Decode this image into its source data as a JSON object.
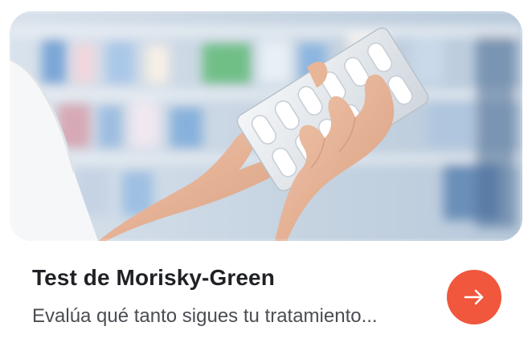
{
  "card": {
    "image_alt_icon": "pharmacy-blister-pack-photo",
    "title": "Test de Morisky-Green",
    "description": "Evalúa qué tanto sigues tu tratamiento...",
    "action_icon": "arrow-right-icon",
    "accent_color": "#f0573c"
  }
}
